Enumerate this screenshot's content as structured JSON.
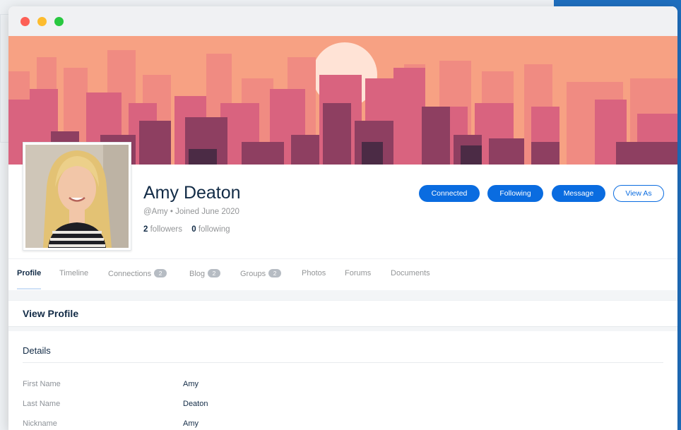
{
  "window": {
    "controls": [
      "close",
      "minimize",
      "maximize"
    ]
  },
  "colors": {
    "accent": "#0a6ce0",
    "cover_sky": "#f7a183",
    "cover_sun": "#ffe3d6"
  },
  "profile": {
    "name": "Amy Deaton",
    "handle": "@Amy",
    "joined": "Joined June 2020",
    "followers_count": "2",
    "followers_label": "followers",
    "following_count": "0",
    "following_label": "following"
  },
  "actions": {
    "connected": "Connected",
    "following": "Following",
    "message": "Message",
    "view_as": "View As"
  },
  "tabs": [
    {
      "label": "Profile",
      "count": null
    },
    {
      "label": "Timeline",
      "count": null
    },
    {
      "label": "Connections",
      "count": "2"
    },
    {
      "label": "Blog",
      "count": "2"
    },
    {
      "label": "Groups",
      "count": "2"
    },
    {
      "label": "Photos",
      "count": null
    },
    {
      "label": "Forums",
      "count": null
    },
    {
      "label": "Documents",
      "count": null
    }
  ],
  "main": {
    "section_title": "View Profile",
    "details_title": "Details",
    "fields": [
      {
        "label": "First Name",
        "value": "Amy"
      },
      {
        "label": "Last Name",
        "value": "Deaton"
      },
      {
        "label": "Nickname",
        "value": "Amy"
      }
    ]
  }
}
